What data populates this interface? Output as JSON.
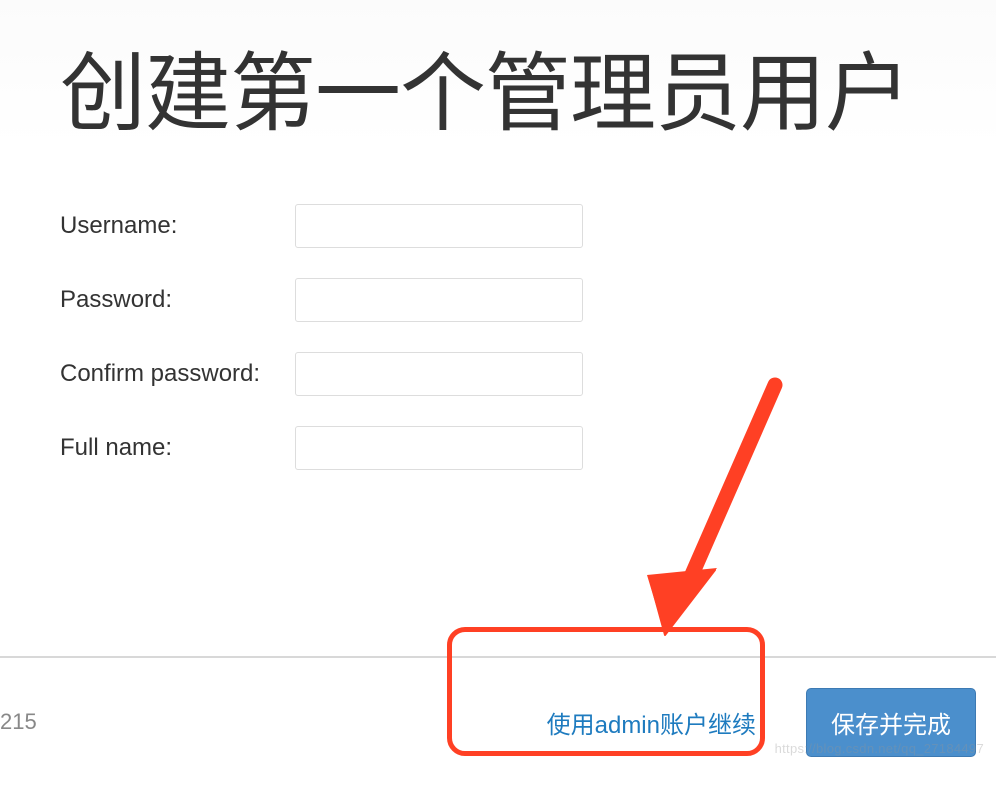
{
  "page": {
    "title": "创建第一个管理员用户"
  },
  "form": {
    "username": {
      "label": "Username:",
      "value": ""
    },
    "password": {
      "label": "Password:",
      "value": ""
    },
    "confirm_password": {
      "label": "Confirm password:",
      "value": ""
    },
    "full_name": {
      "label": "Full name:",
      "value": ""
    }
  },
  "footer": {
    "left_number": "215",
    "continue_link": "使用admin账户继续",
    "save_button": "保存并完成"
  },
  "watermark": "https://blog.csdn.net/qq_27184497",
  "annotation": {
    "arrow_color": "#ff4024",
    "highlight_color": "#ff4024"
  }
}
